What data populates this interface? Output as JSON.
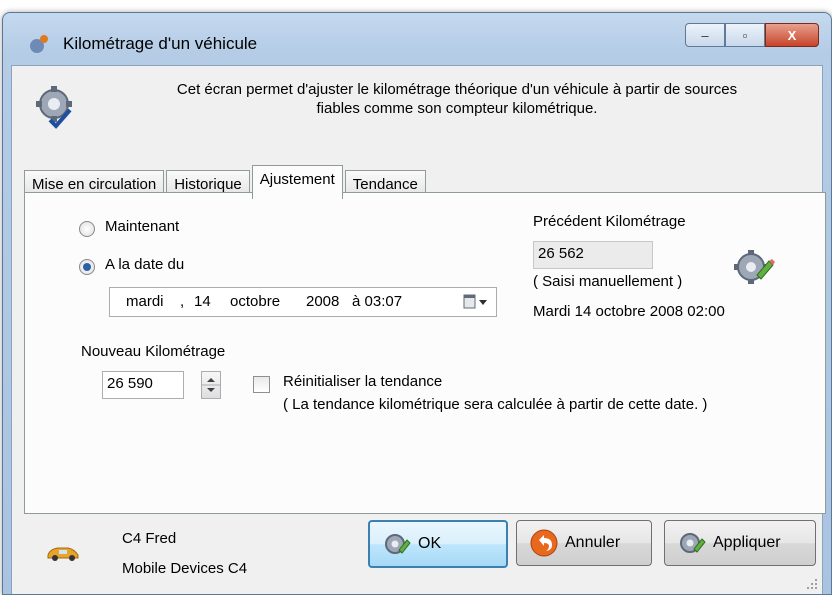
{
  "window": {
    "title": "Kilométrage d'un véhicule",
    "controls": {
      "minimize": "–",
      "maximize": "▫",
      "close": "X"
    }
  },
  "header": {
    "description_line1": "Cet écran permet d'ajuster le kilométrage théorique d'un véhicule à partir de sources",
    "description_line2": "fiables comme son compteur kilométrique."
  },
  "tabs": [
    {
      "label": "Mise en circulation",
      "active": false
    },
    {
      "label": "Historique",
      "active": false
    },
    {
      "label": "Ajustement",
      "active": true
    },
    {
      "label": "Tendance",
      "active": false
    }
  ],
  "adjust": {
    "radio_now": "Maintenant",
    "radio_date": "A la date du",
    "selected": "A la date du",
    "date": {
      "weekday": "mardi",
      "sep": ",",
      "day": "14",
      "month": "octobre",
      "year": "2008",
      "time": "à 03:07"
    },
    "previous": {
      "label": "Précédent Kilométrage",
      "value": "26 562",
      "source": "( Saisi manuellement )",
      "date": "Mardi 14 octobre 2008 02:00"
    },
    "new_label": "Nouveau Kilométrage",
    "new_value": "26 590",
    "reset_label": "Réinitialiser la tendance",
    "reset_checked": false,
    "reset_note": "( La tendance kilométrique sera calculée à partir de cette date. )"
  },
  "vehicle": {
    "name": "C4 Fred",
    "device": "Mobile Devices C4"
  },
  "buttons": {
    "ok": "OK",
    "cancel": "Annuler",
    "apply": "Appliquer"
  },
  "icons": [
    "app-icon",
    "gear-check-icon",
    "gear-pencil-icon",
    "calendar-dropdown-icon",
    "car-icon",
    "cancel-arrow-icon"
  ],
  "colors": {
    "accent": "#2d5fa8",
    "close": "#c7442a",
    "default_button": "#3c7fb1"
  }
}
